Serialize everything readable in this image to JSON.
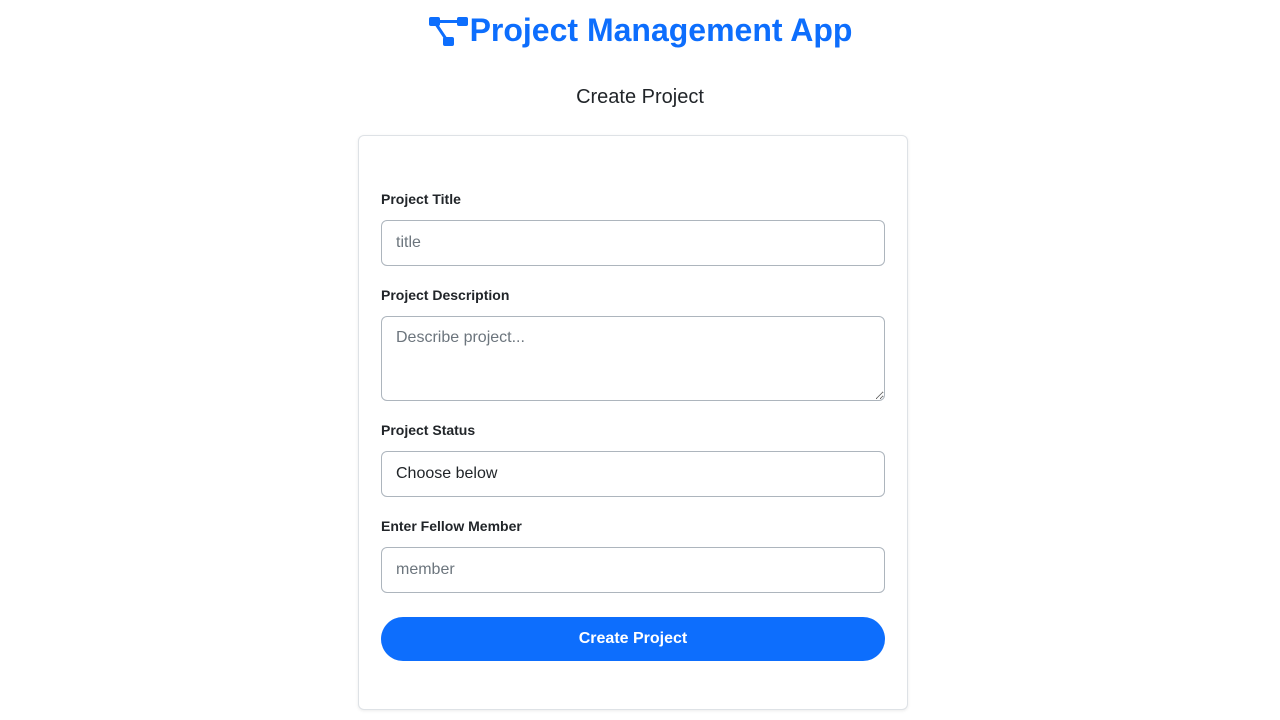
{
  "colors": {
    "accent": "#0d6efd"
  },
  "header": {
    "title": "Project Management App",
    "logo_icon": "project-diagram-icon"
  },
  "page": {
    "subtitle": "Create Project"
  },
  "form": {
    "title_label": "Project Title",
    "title_placeholder": "title",
    "title_value": "",
    "description_label": "Project Description",
    "description_placeholder": "Describe project...",
    "description_value": "",
    "status_label": "Project Status",
    "status_selected": "Choose below",
    "member_label": "Enter Fellow Member",
    "member_placeholder": "member",
    "member_value": "",
    "submit_label": "Create Project"
  }
}
